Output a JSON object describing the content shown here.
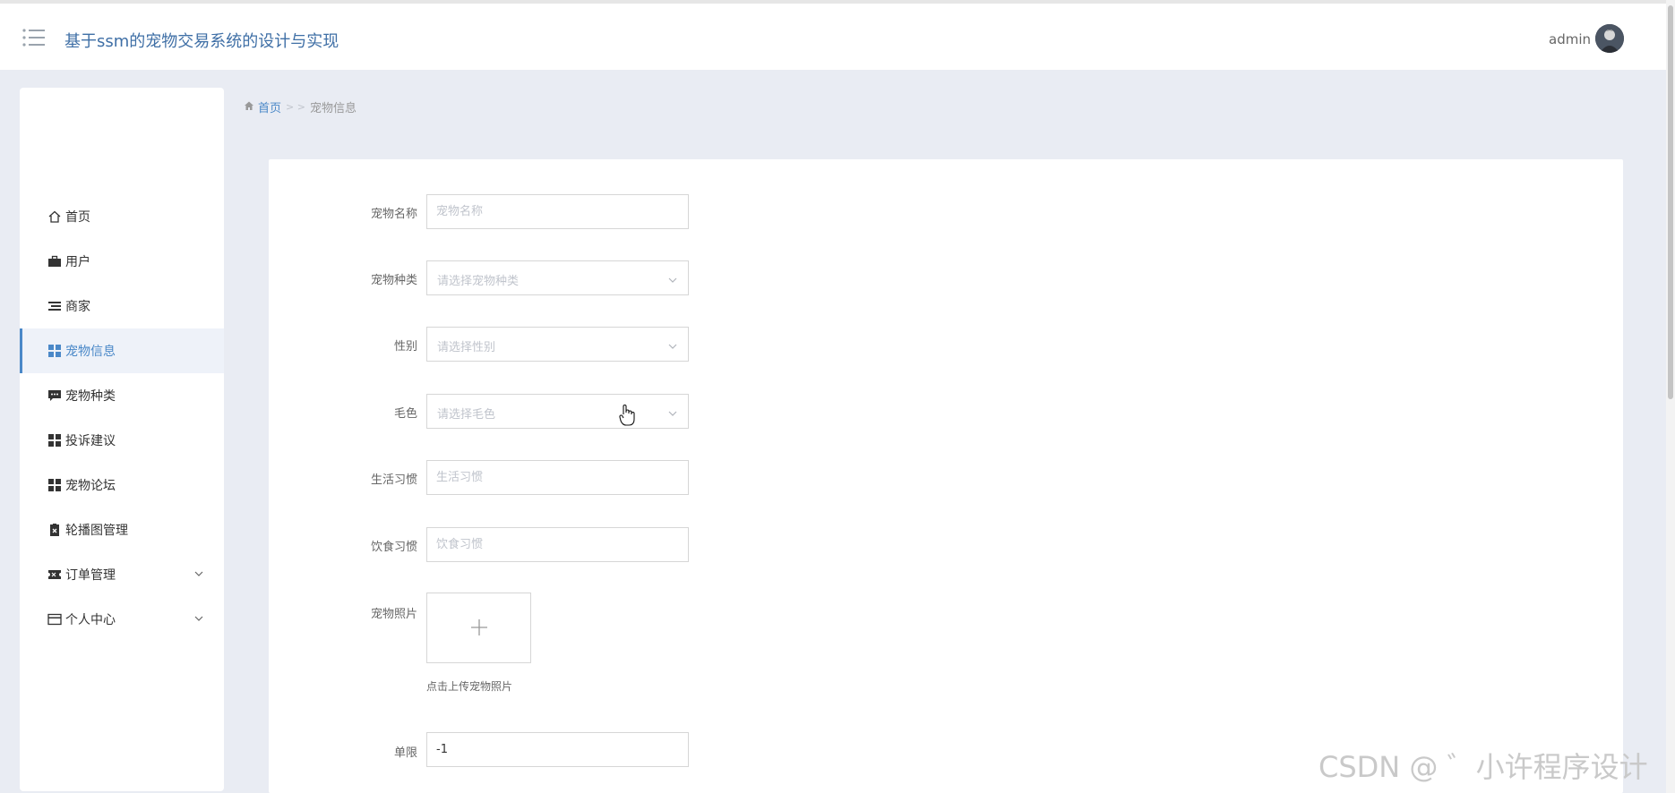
{
  "header": {
    "title": "基于ssm的宠物交易系统的设计与实现",
    "username": "admin"
  },
  "sidebar": {
    "items": [
      {
        "label": "首页",
        "icon": "home-icon"
      },
      {
        "label": "用户",
        "icon": "briefcase-icon"
      },
      {
        "label": "商家",
        "icon": "list-icon"
      },
      {
        "label": "宠物信息",
        "icon": "grid-icon",
        "active": true
      },
      {
        "label": "宠物种类",
        "icon": "chat-icon"
      },
      {
        "label": "投诉建议",
        "icon": "grid-icon"
      },
      {
        "label": "宠物论坛",
        "icon": "grid-icon"
      },
      {
        "label": "轮播图管理",
        "icon": "clipboard-icon"
      },
      {
        "label": "订单管理",
        "icon": "ticket-icon",
        "expandable": true
      },
      {
        "label": "个人中心",
        "icon": "wallet-icon",
        "expandable": true
      }
    ]
  },
  "breadcrumb": {
    "home": "首页",
    "separator": "> >",
    "current": "宠物信息"
  },
  "form": {
    "pet_name": {
      "label": "宠物名称",
      "placeholder": "宠物名称",
      "value": ""
    },
    "pet_type": {
      "label": "宠物种类",
      "placeholder": "请选择宠物种类"
    },
    "gender": {
      "label": "性别",
      "placeholder": "请选择性别"
    },
    "fur_color": {
      "label": "毛色",
      "placeholder": "请选择毛色"
    },
    "habits": {
      "label": "生活习惯",
      "placeholder": "生活习惯",
      "value": ""
    },
    "diet": {
      "label": "饮食习惯",
      "placeholder": "饮食习惯",
      "value": ""
    },
    "photo": {
      "label": "宠物照片",
      "plus": "+",
      "hint": "点击上传宠物照片"
    },
    "limit": {
      "label": "单限",
      "value": "-1"
    }
  },
  "watermark": "CSDN @ ゛小许程序设计",
  "colors": {
    "accent": "#4a88c8",
    "title": "#3f6fa6",
    "background": "#e9ecf3"
  }
}
